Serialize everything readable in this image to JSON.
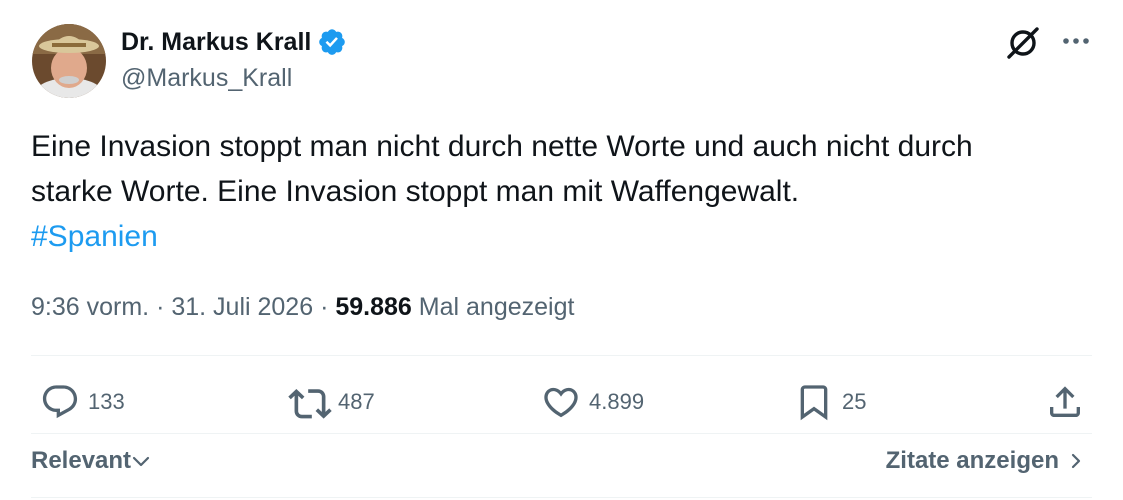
{
  "author": {
    "display_name": "Dr. Markus Krall",
    "handle": "@Markus_Krall",
    "verified": true
  },
  "tweet": {
    "text_lines": [
      "Eine Invasion stoppt man nicht durch nette Worte und auch nicht durch",
      "starke Worte. Eine Invasion stoppt man mit Waffengewalt."
    ],
    "hashtag": "#Spanien"
  },
  "meta": {
    "time": "9:36 vorm.",
    "separator": "·",
    "date": "31. Juli 2026",
    "views_count": "59.886",
    "views_label": "Mal angezeigt"
  },
  "actions": {
    "replies": "133",
    "reposts": "487",
    "likes": "4.899",
    "bookmarks": "25"
  },
  "footer": {
    "sort_label": "Relevant",
    "quotes_label": "Zitate anzeigen"
  },
  "colors": {
    "text": "#0f1419",
    "secondary": "#536471",
    "link": "#1d9bf0",
    "verified": "#1d9bf0",
    "divider": "#eff3f4"
  },
  "icons": [
    "verified-badge-icon",
    "grok-icon",
    "more-icon",
    "reply-icon",
    "repost-icon",
    "like-icon",
    "bookmark-icon",
    "share-icon",
    "chevron-down-icon",
    "chevron-right-icon"
  ]
}
